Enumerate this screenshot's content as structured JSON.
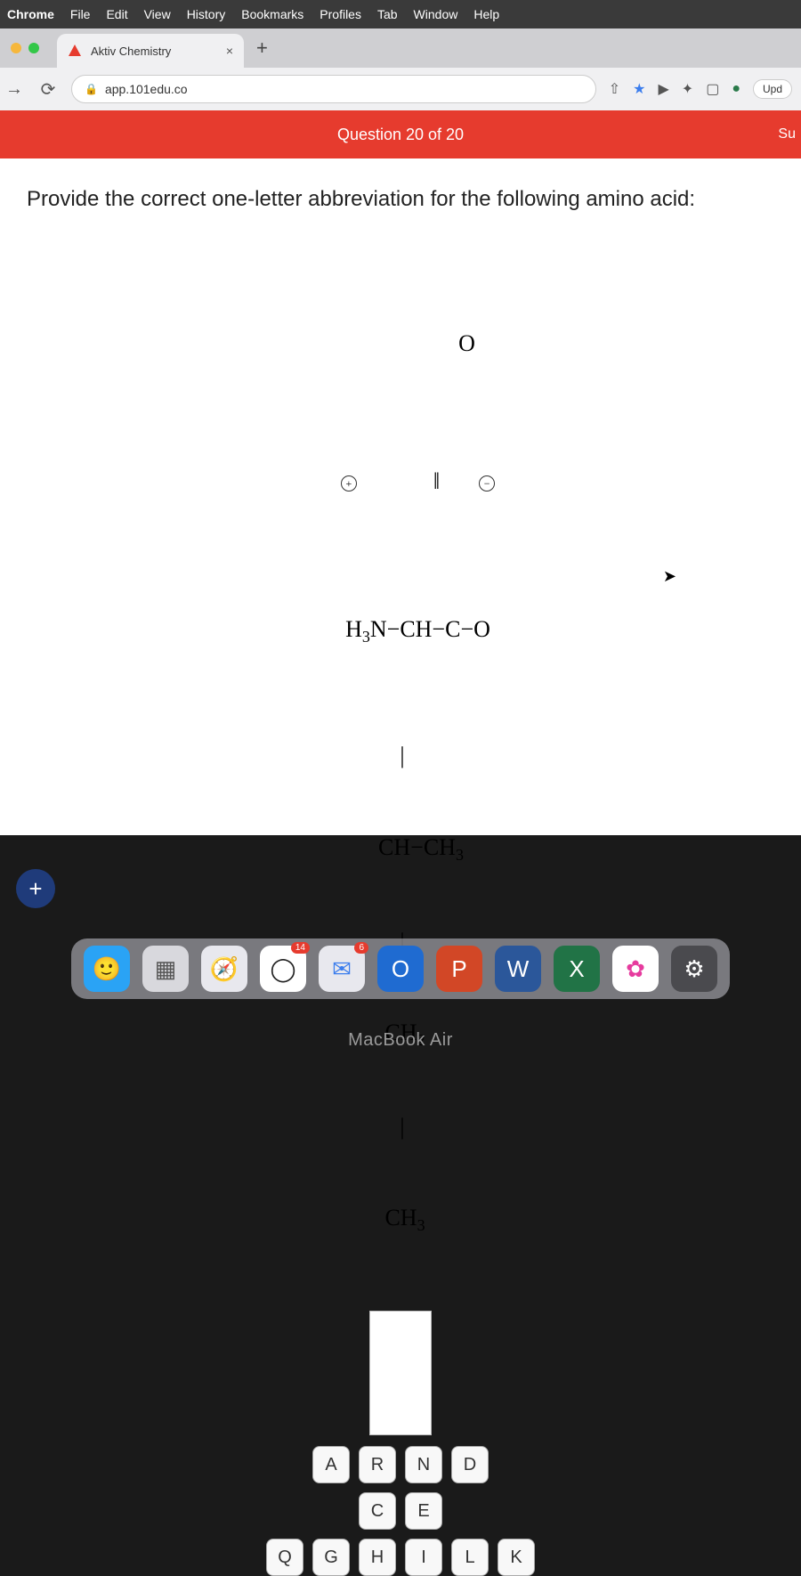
{
  "menubar": {
    "app": "Chrome",
    "items": [
      "File",
      "Edit",
      "View",
      "History",
      "Bookmarks",
      "Profiles",
      "Tab",
      "Window",
      "Help"
    ]
  },
  "browser": {
    "tab_title": "Aktiv Chemistry",
    "tab_close": "×",
    "tab_plus": "+",
    "nav_back": "←",
    "nav_forward": "→",
    "nav_reload": "⟳",
    "lock": "🔒",
    "url": "app.101edu.co",
    "icons": {
      "share": "⇧",
      "star": "★",
      "video": "▶",
      "puzzle": "✦",
      "window": "▢",
      "profile": "●"
    },
    "update_label": "Upd"
  },
  "quiz": {
    "header": "Question 20 of 20",
    "header_right": "Su",
    "prompt": "Provide the correct one-letter abbreviation for the following amino acid:",
    "structure": {
      "line1_pre": "H",
      "line1_sub": "3",
      "line1_post": "N−CH−C−O",
      "top_o": "O",
      "top_dbl": "‖",
      "plus": "+",
      "minus": "−",
      "line2_pre": "CH−CH",
      "line2_sub": "3",
      "line3_pre": "CH",
      "line3_sub": "2",
      "line4_pre": "CH",
      "line4_sub": "3",
      "pipe": "|"
    },
    "rows": [
      [
        "A",
        "R",
        "N",
        "D"
      ],
      [
        "C",
        "E"
      ],
      [
        "Q",
        "G",
        "H",
        "I",
        "L",
        "K"
      ]
    ],
    "fab": "+"
  },
  "dock": {
    "items": [
      {
        "name": "finder",
        "bg": "#2aa3f5",
        "glyph": "🙂",
        "badge": ""
      },
      {
        "name": "launchpad",
        "bg": "#d8d8dd",
        "glyph": "▦",
        "badge": ""
      },
      {
        "name": "safari",
        "bg": "#e8e8ee",
        "glyph": "🧭",
        "badge": ""
      },
      {
        "name": "chrome",
        "bg": "#ffffff",
        "glyph": "◯",
        "badge": "14"
      },
      {
        "name": "mail",
        "bg": "#e8e8ee",
        "glyph": "✉",
        "badge": "6"
      },
      {
        "name": "outlook",
        "bg": "#1f6bd1",
        "glyph": "O",
        "badge": ""
      },
      {
        "name": "powerpoint",
        "bg": "#d24726",
        "glyph": "P",
        "badge": ""
      },
      {
        "name": "word",
        "bg": "#2b579a",
        "glyph": "W",
        "badge": ""
      },
      {
        "name": "excel",
        "bg": "#217346",
        "glyph": "X",
        "badge": ""
      },
      {
        "name": "photos",
        "bg": "#ffffff",
        "glyph": "✿",
        "badge": ""
      },
      {
        "name": "settings",
        "bg": "#4a4a4e",
        "glyph": "⚙",
        "badge": ""
      }
    ]
  },
  "footer": {
    "label": "MacBook Air"
  }
}
